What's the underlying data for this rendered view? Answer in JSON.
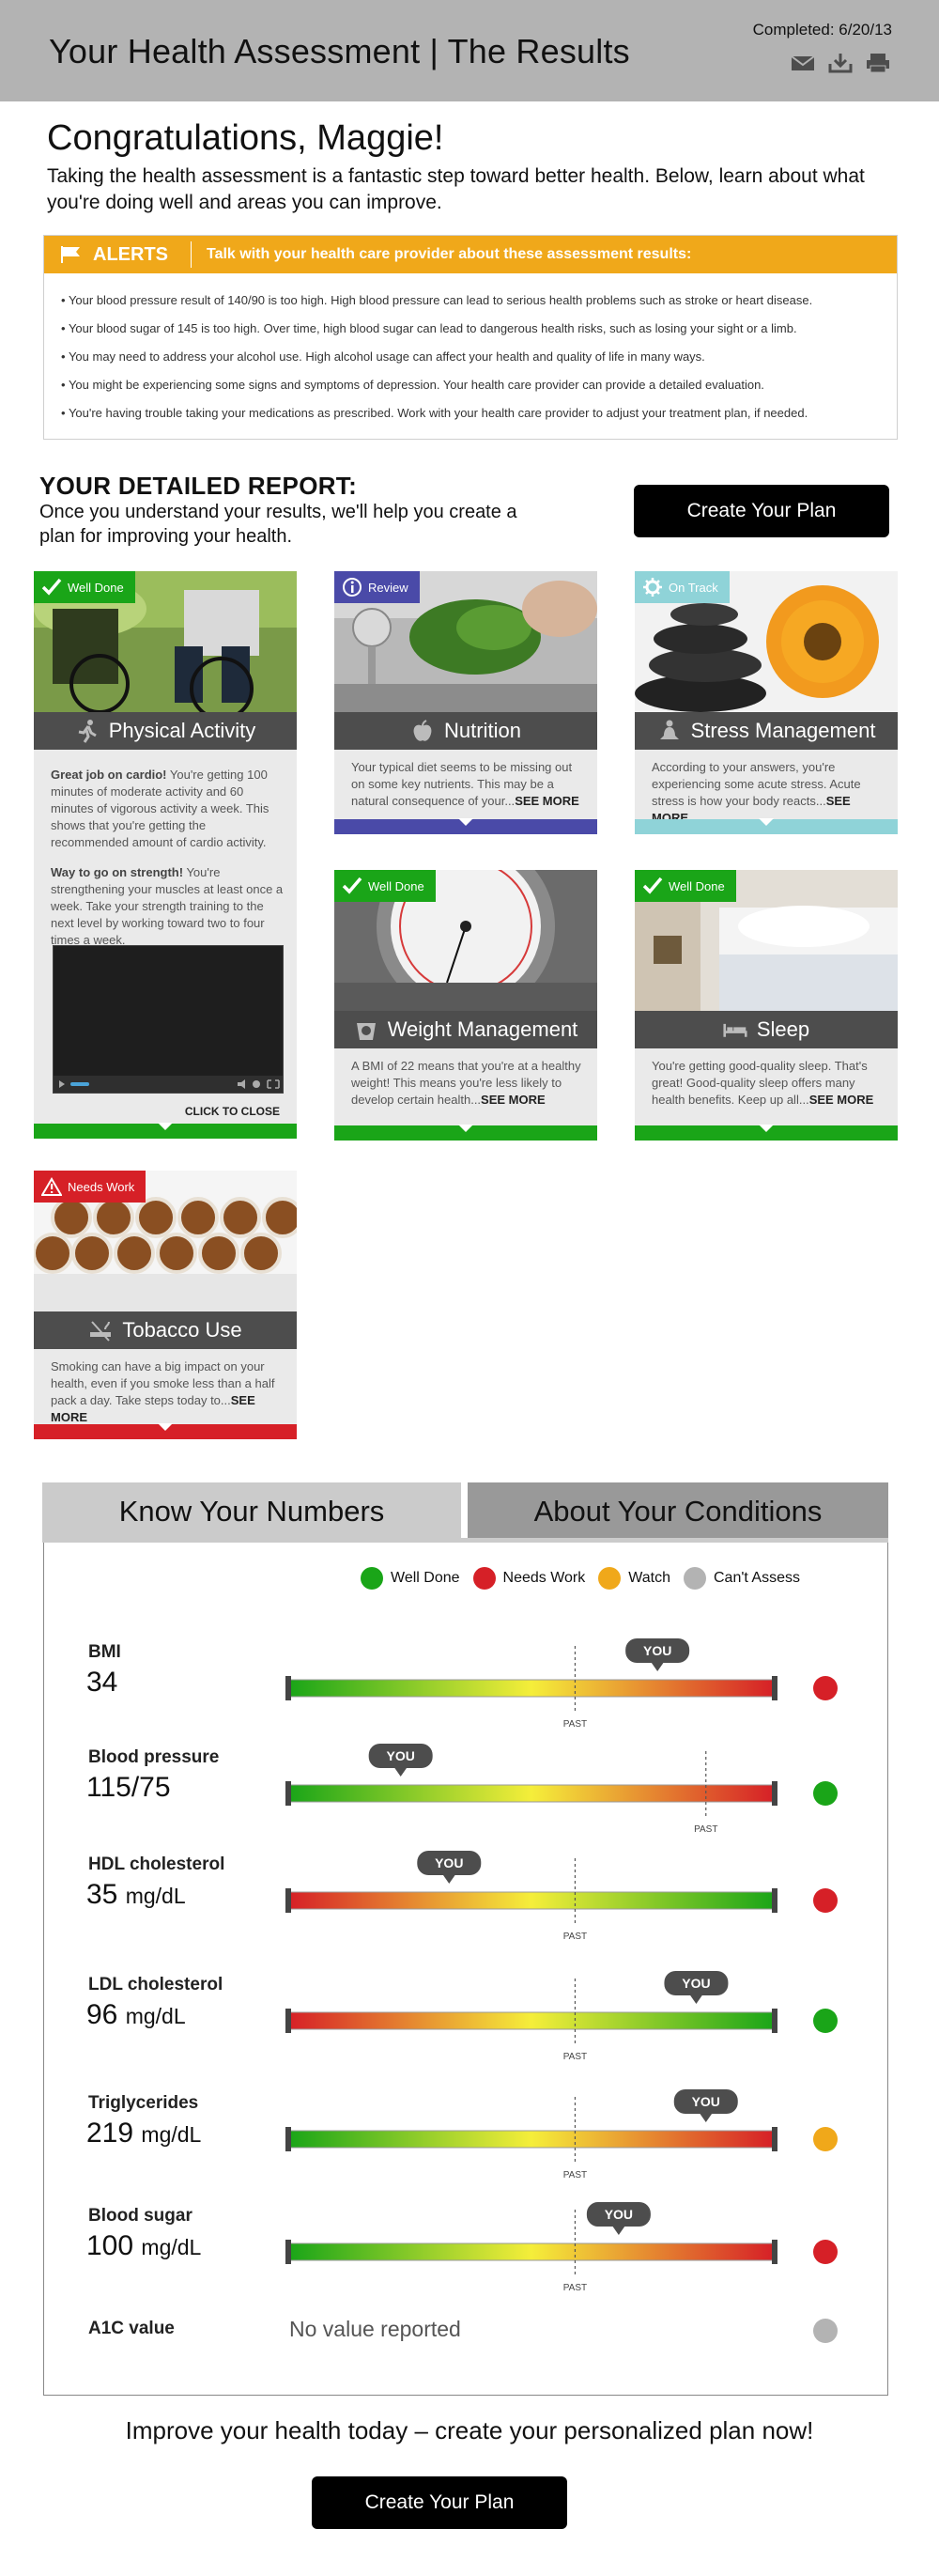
{
  "header": {
    "title": "Your Health Assessment | The Results",
    "completed": "Completed: 6/20/13",
    "icons": [
      "mail-icon",
      "download-icon",
      "print-icon"
    ]
  },
  "greeting": "Congratulations, Maggie!",
  "intro": "Taking the health assessment is a fantastic step toward better health. Below, learn about what you're doing well and areas you can improve.",
  "alerts": {
    "title": "ALERTS",
    "subtitle": "Talk with your health care provider about these assessment results:",
    "items": [
      "Your blood pressure result of 140/90 is too high. High blood pressure can lead to serious health problems such as stroke or heart disease.",
      "Your blood sugar of 145 is too high. Over time, high blood sugar can lead to dangerous health risks, such as losing your sight or a limb.",
      "You may need to address your alcohol use. High alcohol usage can affect your health and quality of life in many ways.",
      "You might be experiencing some signs and symptoms of depression. Your health care provider can provide a detailed evaluation.",
      "You're having trouble taking your medications as prescribed. Work with your health care provider to adjust your treatment plan, if needed."
    ],
    "color": "#f0a81a"
  },
  "report": {
    "title": "YOUR DETAILED REPORT:",
    "subtitle": "Once you understand your results, we'll help you create a plan for improving your health.",
    "button": "Create Your Plan"
  },
  "cards": {
    "physical": {
      "badge": "Well Done",
      "title": "Physical Activity",
      "p1_bold": "Great job on cardio!",
      "p1": " You're getting 100 minutes of moderate activity and 60 minutes of vigorous activity a week. This shows that you're getting the recommended amount of cardio activity.",
      "p2_bold": "Way to go on strength!",
      "p2": " You're strengthening your muscles at least once a week. Take your strength training to the next level by working toward two to four times a week.",
      "close": "CLICK TO CLOSE"
    },
    "nutrition": {
      "badge": "Review",
      "title": "Nutrition",
      "text": "Your typical diet seems to be missing out on some key nutrients. This may be a natural consequence of your...",
      "more": "SEE MORE"
    },
    "stress": {
      "badge": "On Track",
      "title": "Stress Management",
      "text": "According to your answers, you're experiencing some acute stress. Acute stress is how your body reacts...",
      "more": "SEE MORE"
    },
    "weight": {
      "badge": "Well Done",
      "title": "Weight Management",
      "text": "A BMI of 22 means that you're at a healthy weight! This means you're less likely to develop certain health...",
      "more": "SEE MORE"
    },
    "sleep": {
      "badge": "Well Done",
      "title": "Sleep",
      "text": "You're getting good-quality sleep. That's great! Good-quality sleep offers many health benefits. Keep up all...",
      "more": "SEE MORE"
    },
    "tobacco": {
      "badge": "Needs Work",
      "title": "Tobacco Use",
      "text": "Smoking can have a big impact on your health, even if you smoke less than a half pack a day. Take steps today to...",
      "more": "SEE MORE"
    }
  },
  "colors": {
    "well_done": "#1aa518",
    "needs_work": "#d62027",
    "watch": "#f0a81a",
    "cant_assess": "#b3b3b3",
    "review": "#4a4aa8",
    "on_track": "#8fd3d8"
  },
  "tabs": {
    "numbers": "Know Your Numbers",
    "conditions": "About Your Conditions"
  },
  "legend": {
    "well_done": "Well Done",
    "needs_work": "Needs Work",
    "watch": "Watch",
    "cant_assess": "Can't Assess"
  },
  "markers": {
    "you": "YOU",
    "past": "PAST"
  },
  "metrics": [
    {
      "name": "BMI",
      "value": "34",
      "unit": "",
      "scale": "green-red",
      "you": 0.76,
      "past": 0.59,
      "status": "needs_work"
    },
    {
      "name": "Blood pressure",
      "value": "115/75",
      "unit": "",
      "scale": "green-red",
      "you": 0.23,
      "past": 0.86,
      "status": "well_done"
    },
    {
      "name": "HDL cholesterol",
      "value": "35",
      "unit": "mg/dL",
      "scale": "red-green",
      "you": 0.33,
      "past": 0.59,
      "status": "needs_work"
    },
    {
      "name": "LDL cholesterol",
      "value": "96",
      "unit": "mg/dL",
      "scale": "red-green",
      "you": 0.84,
      "past": 0.59,
      "status": "well_done"
    },
    {
      "name": "Triglycerides",
      "value": "219",
      "unit": "mg/dL",
      "scale": "green-red",
      "you": 0.86,
      "past": 0.59,
      "status": "watch"
    },
    {
      "name": "Blood sugar",
      "value": "100",
      "unit": "mg/dL",
      "scale": "green-red",
      "you": 0.68,
      "past": 0.59,
      "status": "needs_work"
    }
  ],
  "a1c": {
    "name": "A1C value",
    "value": "No value reported",
    "status": "cant_assess"
  },
  "footer": {
    "improve": "Improve your health today – create your personalized plan now!",
    "button": "Create Your Plan"
  }
}
